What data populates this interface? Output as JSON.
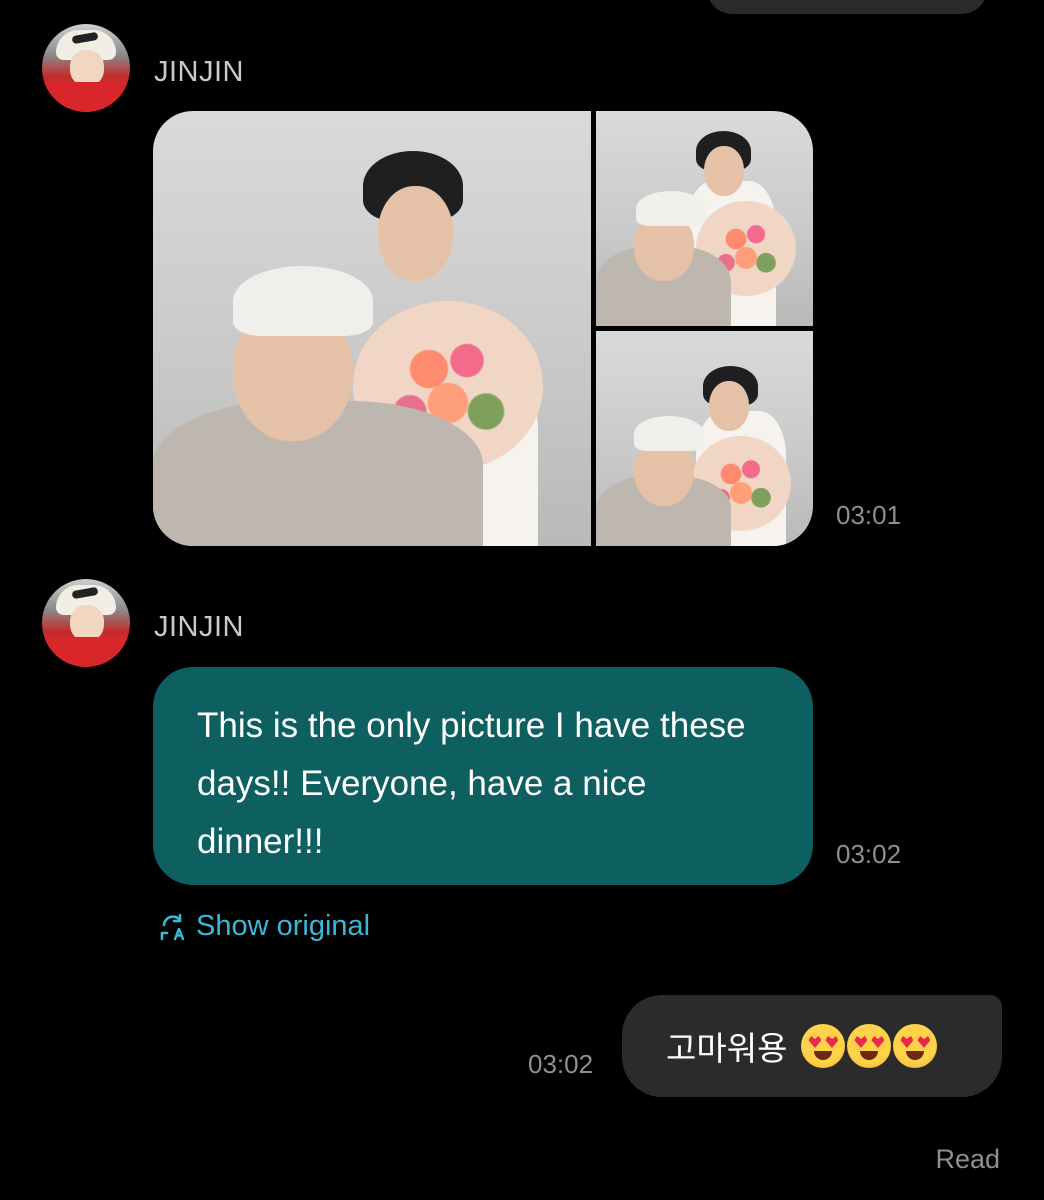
{
  "messages": {
    "incoming_photos": {
      "sender": "JINJIN",
      "avatar_icon": "profile-avatar",
      "time": "03:01",
      "photo_count": 3
    },
    "incoming_text": {
      "sender": "JINJIN",
      "avatar_icon": "profile-avatar",
      "text": "This is the only picture I have these days!! Everyone, have a nice dinner!!!",
      "time": "03:02",
      "show_original_label": "Show original",
      "translate_icon": "translate-icon"
    },
    "outgoing": {
      "text": "고마워용",
      "emoji_icon": "heart-eyes-emoji",
      "emoji_count": 3,
      "time": "03:02",
      "read_status": "Read"
    }
  },
  "colors": {
    "background": "#000000",
    "incoming_bubble": "#0d5f60",
    "outgoing_bubble": "#2b2b2b",
    "link": "#3ab8d6",
    "meta_text": "#8f8f8f"
  }
}
